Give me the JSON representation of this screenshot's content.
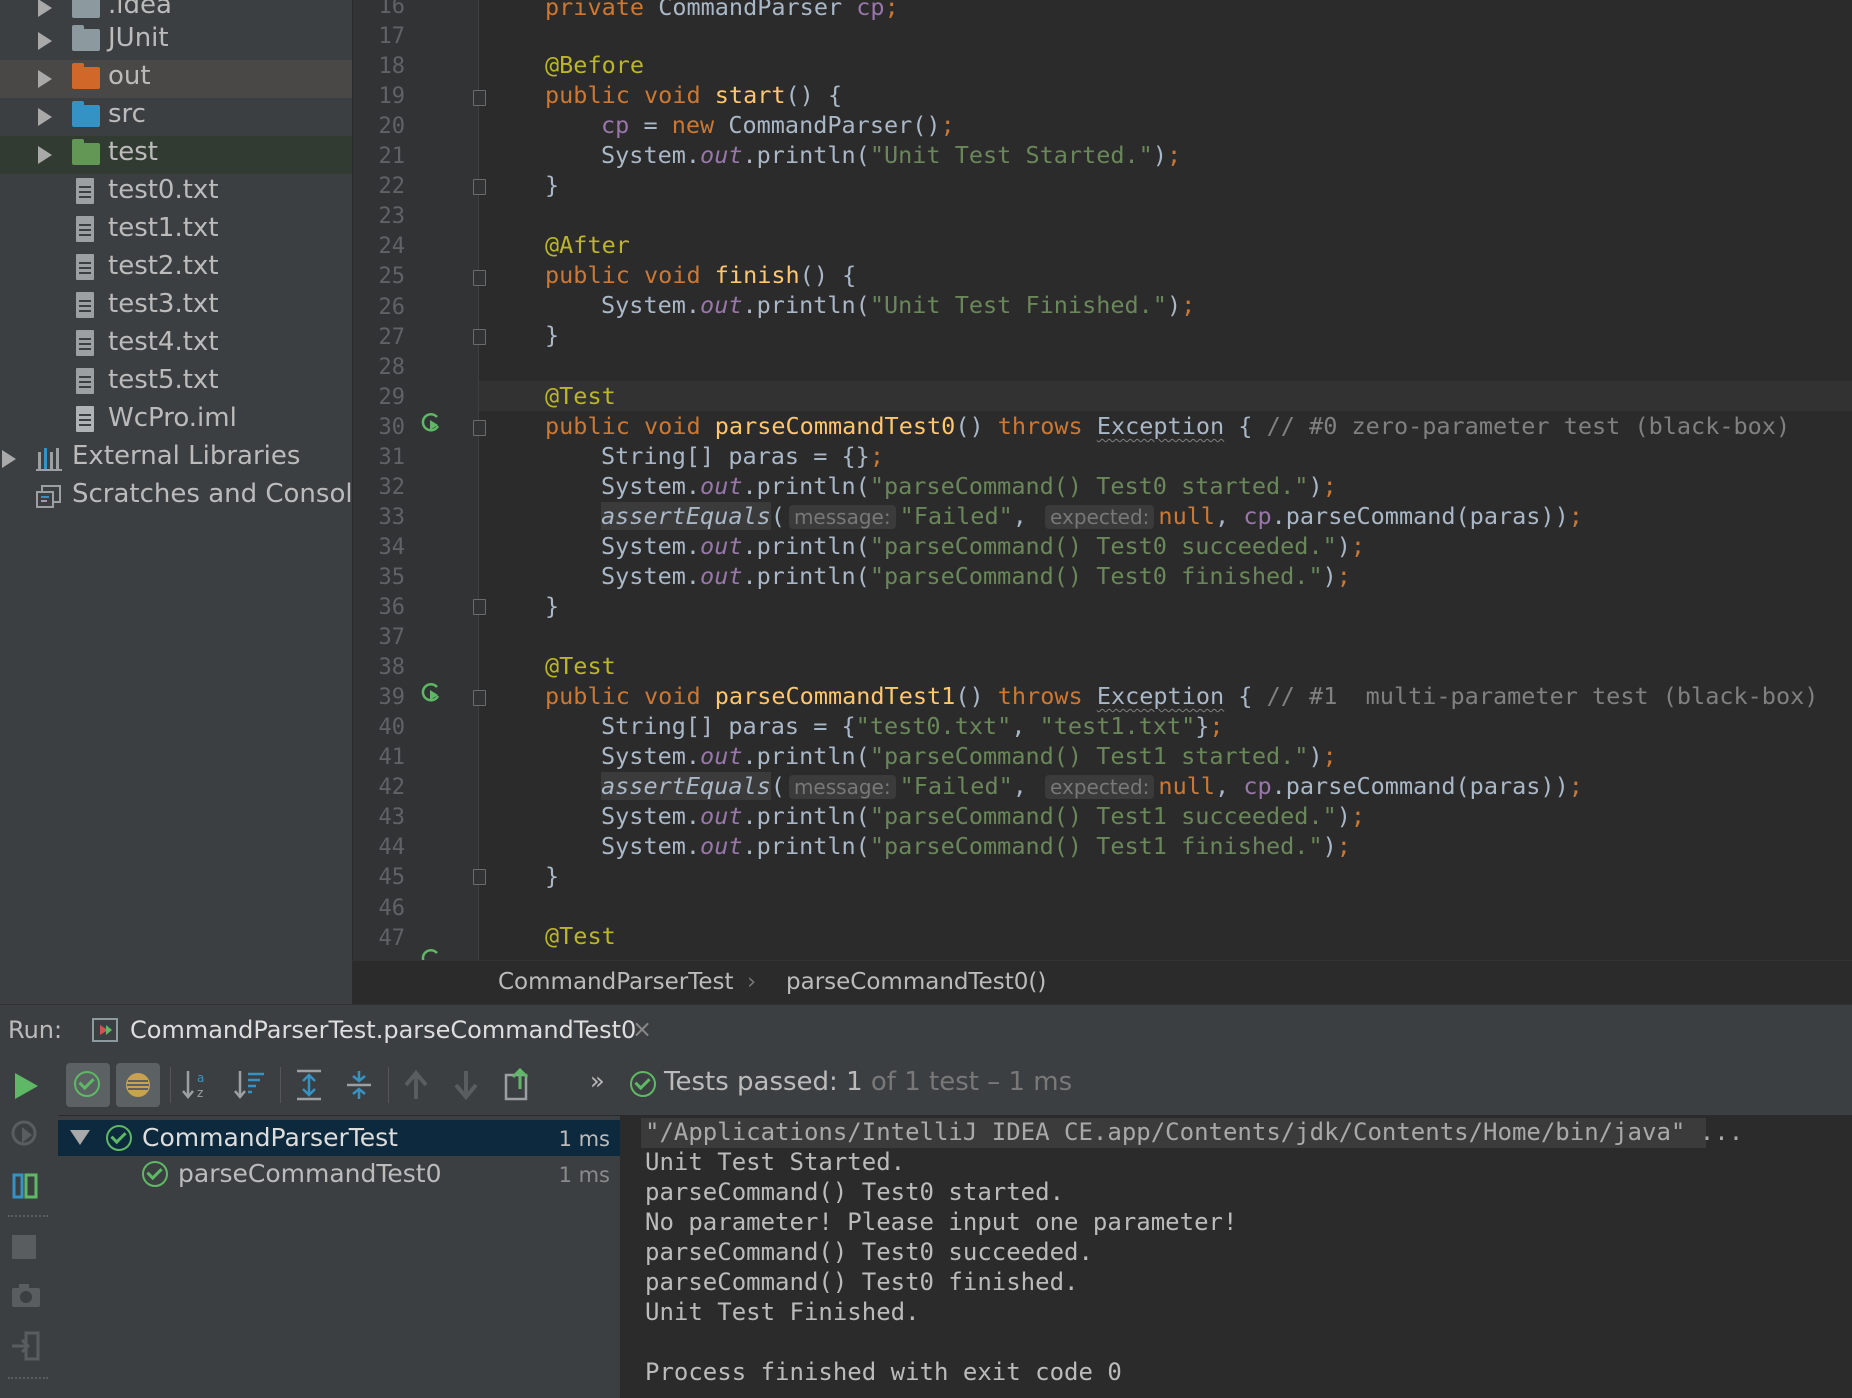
{
  "project_tree": {
    "items": [
      {
        "label": ".idea",
        "type": "folder",
        "color": "#8c9a9f"
      },
      {
        "label": "JUnit",
        "type": "folder",
        "color": "#8c9a9f"
      },
      {
        "label": "out",
        "type": "folder",
        "color": "#d2672a"
      },
      {
        "label": "src",
        "type": "folder",
        "color": "#3592c4"
      },
      {
        "label": "test",
        "type": "folder",
        "color": "#629755"
      },
      {
        "label": "test0.txt",
        "type": "file"
      },
      {
        "label": "test1.txt",
        "type": "file"
      },
      {
        "label": "test2.txt",
        "type": "file"
      },
      {
        "label": "test3.txt",
        "type": "file"
      },
      {
        "label": "test4.txt",
        "type": "file"
      },
      {
        "label": "test5.txt",
        "type": "file"
      },
      {
        "label": "WcPro.iml",
        "type": "file"
      },
      {
        "label": "External Libraries",
        "type": "library"
      },
      {
        "label": "Scratches and Consoles",
        "type": "scratch"
      }
    ]
  },
  "editor": {
    "line_numbers": [
      "16",
      "17",
      "18",
      "19",
      "20",
      "21",
      "22",
      "23",
      "24",
      "25",
      "26",
      "27",
      "28",
      "29",
      "30",
      "31",
      "32",
      "33",
      "34",
      "35",
      "36",
      "37",
      "38",
      "39",
      "40",
      "41",
      "42",
      "43",
      "44",
      "45",
      "46",
      "47"
    ],
    "code": {
      "l16": {
        "kw": "private ",
        "type": "CommandParser ",
        "field": "cp",
        "end": ";"
      },
      "l18": {
        "an": "@Before"
      },
      "l19": {
        "kw": "public void ",
        "fn": "start",
        "rest": "() {"
      },
      "l20": {
        "field": "cp",
        "mid": " = ",
        "kw": "new ",
        "rest": "CommandParser()",
        "end": ";"
      },
      "l21": {
        "pre": "System.",
        "st": "out",
        "mid": ".println(",
        "str": "\"Unit Test Started.\"",
        "post": ")",
        "end": ";"
      },
      "l22": {
        "rest": "}"
      },
      "l24": {
        "an": "@After"
      },
      "l25": {
        "kw": "public void ",
        "fn": "finish",
        "rest": "() {"
      },
      "l26": {
        "pre": "System.",
        "st": "out",
        "mid": ".println(",
        "str": "\"Unit Test Finished.\"",
        "post": ")",
        "end": ";"
      },
      "l27": {
        "rest": "}"
      },
      "l29": {
        "an": "@Test"
      },
      "l30": {
        "kw": "public void ",
        "fn": "parseCommandTest0",
        "paren": "() ",
        "throws": "throws ",
        "exc": "Exception",
        "brace": " { ",
        "cmt": "// #0 zero-parameter test (black-box)"
      },
      "l31": {
        "pre": "String[] paras = {}",
        "end": ";"
      },
      "l32": {
        "pre": "System.",
        "st": "out",
        "mid": ".println(",
        "str": "\"parseCommand() Test0 started.\"",
        "post": ")",
        "end": ";"
      },
      "l33": {
        "fn": "assertEquals",
        "open": "(",
        "hint1": "message:",
        "str": "\"Failed\"",
        "comma1": ", ",
        "hint2": "expected:",
        "kw": "null",
        "comma2": ", ",
        "field": "cp",
        "rest": ".parseCommand(paras))",
        "end": ";"
      },
      "l34": {
        "pre": "System.",
        "st": "out",
        "mid": ".println(",
        "str": "\"parseCommand() Test0 succeeded.\"",
        "post": ")",
        "end": ";"
      },
      "l35": {
        "pre": "System.",
        "st": "out",
        "mid": ".println(",
        "str": "\"parseCommand() Test0 finished.\"",
        "post": ")",
        "end": ";"
      },
      "l36": {
        "rest": "}"
      },
      "l38": {
        "an": "@Test"
      },
      "l39": {
        "kw": "public void ",
        "fn": "parseCommandTest1",
        "paren": "() ",
        "throws": "throws ",
        "exc": "Exception",
        "brace": " { ",
        "cmt": "// #1  multi-parameter test (black-box)"
      },
      "l40": {
        "pre": "String[] paras = {",
        "str1": "\"test0.txt\"",
        "comma": ", ",
        "str2": "\"test1.txt\"",
        "post": "}",
        "end": ";"
      },
      "l41": {
        "pre": "System.",
        "st": "out",
        "mid": ".println(",
        "str": "\"parseCommand() Test1 started.\"",
        "post": ")",
        "end": ";"
      },
      "l42": {
        "fn": "assertEquals",
        "open": "(",
        "hint1": "message:",
        "str": "\"Failed\"",
        "comma1": ", ",
        "hint2": "expected:",
        "kw": "null",
        "comma2": ", ",
        "field": "cp",
        "rest": ".parseCommand(paras))",
        "end": ";"
      },
      "l43": {
        "pre": "System.",
        "st": "out",
        "mid": ".println(",
        "str": "\"parseCommand() Test1 succeeded.\"",
        "post": ")",
        "end": ";"
      },
      "l44": {
        "pre": "System.",
        "st": "out",
        "mid": ".println(",
        "str": "\"parseCommand() Test1 finished.\"",
        "post": ")",
        "end": ";"
      },
      "l45": {
        "rest": "}"
      },
      "l47": {
        "an": "@Test"
      }
    }
  },
  "breadcrumb": {
    "class_name": "CommandParserTest",
    "separator": "›",
    "method_name": "parseCommandTest0()"
  },
  "run": {
    "label": "Run:",
    "tab_title": "CommandParserTest.parseCommandTest0",
    "close": "×",
    "status_prefix": "Tests passed: ",
    "status_count": "1",
    "status_suffix": " of 1 test – 1 ms",
    "more": "»",
    "tests": [
      {
        "name": "CommandParserTest",
        "time": "1 ms"
      },
      {
        "name": "parseCommandTest0",
        "time": "1 ms"
      }
    ],
    "console": [
      "\"/Applications/IntelliJ IDEA CE.app/Contents/jdk/Contents/Home/bin/java\" ...",
      "Unit Test Started.",
      "parseCommand() Test0 started.",
      "No parameter! Please input one parameter!",
      "parseCommand() Test0 succeeded.",
      "parseCommand() Test0 finished.",
      "Unit Test Finished.",
      "",
      "Process finished with exit code 0"
    ]
  },
  "colors": {
    "pass_green": "#5fb865",
    "selection_blue": "#0d293e",
    "keyword": "#cc7832",
    "string": "#6a8759",
    "annotation": "#bbb529"
  }
}
